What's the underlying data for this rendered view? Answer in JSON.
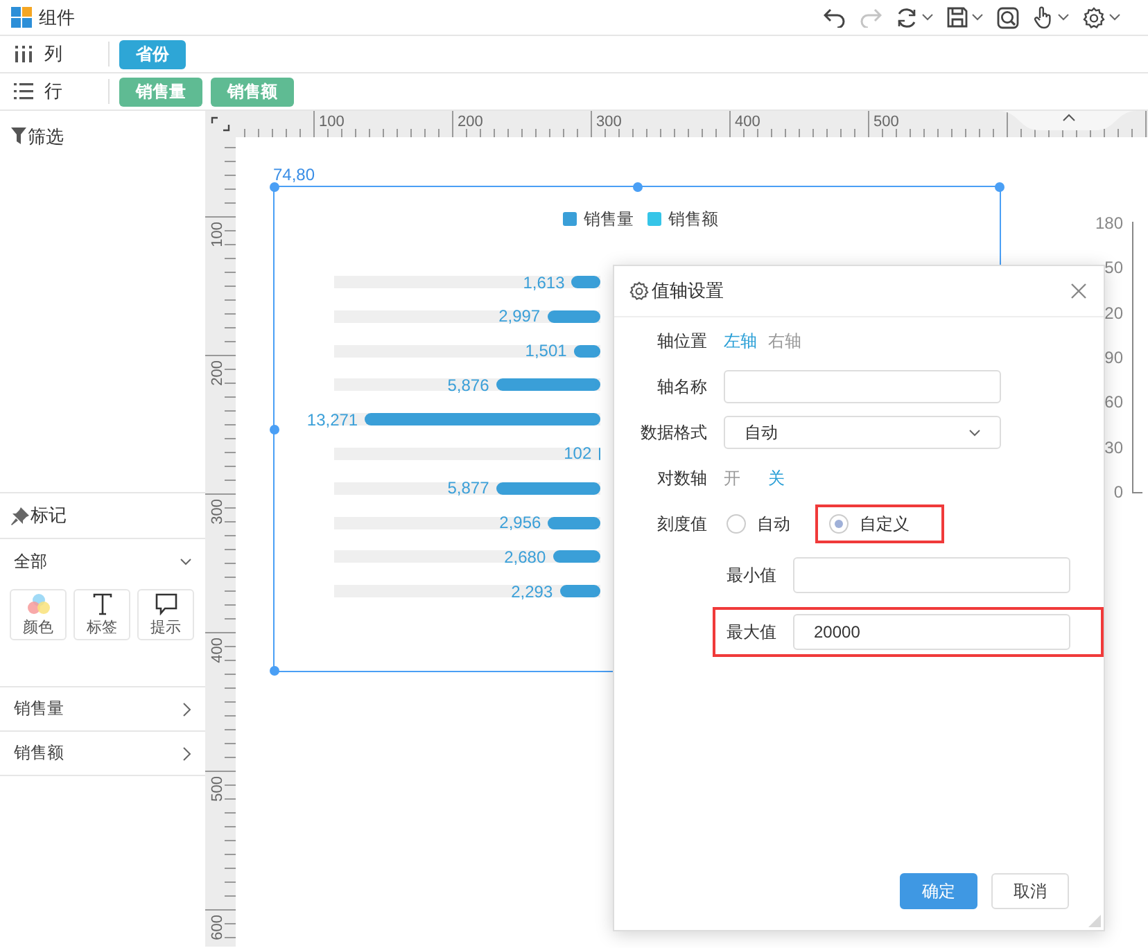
{
  "header": {
    "title": "组件"
  },
  "toolbar": [
    {
      "kind": "undo",
      "disabled": false,
      "dropdown": false
    },
    {
      "kind": "redo",
      "disabled": true,
      "dropdown": false
    },
    {
      "kind": "refresh",
      "disabled": false,
      "dropdown": true
    },
    {
      "kind": "save",
      "disabled": false,
      "dropdown": true
    },
    {
      "kind": "preview",
      "disabled": false,
      "dropdown": false
    },
    {
      "kind": "hand",
      "disabled": false,
      "dropdown": true
    },
    {
      "kind": "settings",
      "disabled": false,
      "dropdown": true
    }
  ],
  "shelves": [
    {
      "kind": "columns",
      "label": "列",
      "color": "#2ea6d6",
      "pills": [
        "省份"
      ]
    },
    {
      "kind": "rows",
      "label": "行",
      "color": "#5fbb93",
      "pills": [
        "销售量",
        "销售额"
      ]
    }
  ],
  "sidebar": {
    "filter_title": "筛选",
    "marks_title": "标记",
    "mark_type": "全部",
    "mark_buttons": [
      {
        "kind": "color",
        "label": "颜色"
      },
      {
        "kind": "label",
        "label": "标签"
      },
      {
        "kind": "tooltip",
        "label": "提示"
      }
    ],
    "fields": [
      {
        "label": "销售量"
      },
      {
        "label": "销售额"
      }
    ]
  },
  "ruler": {
    "horizontal": [
      "100",
      "200",
      "300",
      "400",
      "500"
    ],
    "vertical": [
      "100",
      "200",
      "300",
      "400",
      "500",
      "600"
    ]
  },
  "chart": {
    "position_label": "74,80",
    "selected": true,
    "legend": [
      {
        "name": "销售量",
        "color": "#3a9fd8"
      },
      {
        "name": "销售额",
        "color": "#36c5e8"
      }
    ],
    "bars": [
      {
        "label": "1,613",
        "level": 0.108
      },
      {
        "label": "2,997",
        "level": 0.2
      },
      {
        "label": "1,501",
        "level": 0.1
      },
      {
        "label": "5,876",
        "level": 0.392
      },
      {
        "label": "13,271",
        "level": 0.885
      },
      {
        "label": "102",
        "level": 0.007
      },
      {
        "label": "5,877",
        "level": 0.392
      },
      {
        "label": "2,956",
        "level": 0.197
      },
      {
        "label": "2,680",
        "level": 0.179
      },
      {
        "label": "2,293",
        "level": 0.153
      }
    ]
  },
  "background_chart": {
    "axis_labels": [
      "180",
      "50",
      "20",
      "90",
      "60",
      "30",
      "0"
    ]
  },
  "dialog": {
    "title": "值轴设置",
    "fields": [
      {
        "kind": "options",
        "label": "轴位置",
        "options": [
          {
            "label": "左轴",
            "selected": true
          },
          {
            "label": "右轴",
            "selected": false
          }
        ]
      },
      {
        "kind": "input",
        "label": "轴名称"
      },
      {
        "kind": "select",
        "label": "数据格式",
        "value": "自动"
      },
      {
        "kind": "options",
        "label": "对数轴",
        "options": [
          {
            "label": "开",
            "selected": false
          },
          {
            "label": "关",
            "selected": true
          }
        ]
      },
      {
        "kind": "radio",
        "label": "刻度值",
        "options": [
          {
            "label": "自动",
            "selected": false,
            "highlighted": false
          },
          {
            "label": "自定义",
            "selected": true,
            "highlighted": true
          }
        ]
      },
      {
        "kind": "sub_input",
        "label": "最小值",
        "highlighted": false
      },
      {
        "kind": "sub_input",
        "label": "最大值",
        "value": "20000",
        "highlighted": true
      }
    ],
    "buttons": [
      {
        "label": "确定",
        "primary": true
      },
      {
        "label": "取消",
        "primary": false
      }
    ]
  }
}
